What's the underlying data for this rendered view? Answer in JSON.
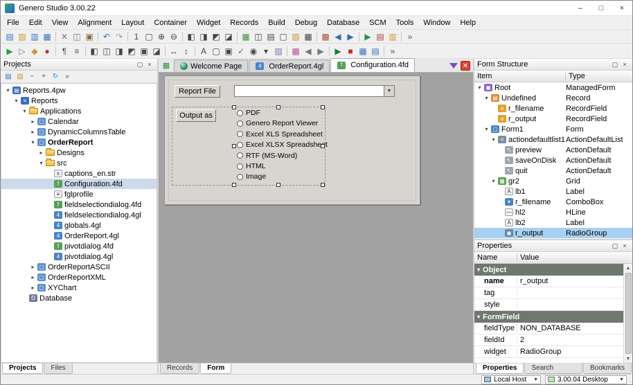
{
  "window": {
    "title": "Genero Studio 3.00.22",
    "controls": [
      {
        "name": "minimize-button",
        "glyph": "–"
      },
      {
        "name": "maximize-button",
        "glyph": "□"
      },
      {
        "name": "close-button",
        "glyph": "×"
      }
    ]
  },
  "menu": {
    "items": [
      "File",
      "Edit",
      "View",
      "Alignment",
      "Layout",
      "Container",
      "Widget",
      "Records",
      "Build",
      "Debug",
      "Database",
      "SCM",
      "Tools",
      "Window",
      "Help"
    ]
  },
  "toolbars": {
    "row1": [
      {
        "name": "new-file",
        "glyph": "▤",
        "color": "#3a6fc4"
      },
      {
        "name": "open-file",
        "glyph": "▧",
        "color": "#c9973a"
      },
      {
        "name": "save-file",
        "glyph": "▥",
        "color": "#3a6fc4"
      },
      {
        "name": "save-all",
        "glyph": "▦",
        "color": "#3a6fc4"
      },
      {
        "sep": true
      },
      {
        "name": "cut",
        "glyph": "✕",
        "color": "#777777"
      },
      {
        "name": "copy",
        "glyph": "◫",
        "color": "#777777"
      },
      {
        "name": "paste",
        "glyph": "▣",
        "color": "#8a6d3b"
      },
      {
        "sep": true
      },
      {
        "name": "undo",
        "glyph": "↶",
        "color": "#3a6fc4"
      },
      {
        "name": "redo",
        "glyph": "↷",
        "color": "#9aa4b0"
      },
      {
        "sep": true
      },
      {
        "name": "tab-order",
        "glyph": "1",
        "color": "#444444"
      },
      {
        "name": "preview-form",
        "glyph": "▢",
        "color": "#444444"
      },
      {
        "name": "zoom-in",
        "glyph": "⊕",
        "color": "#444444"
      },
      {
        "name": "zoom-out",
        "glyph": "⊖",
        "color": "#444444"
      },
      {
        "sep": true
      },
      {
        "name": "align-left-edges",
        "glyph": "◧",
        "color": "#444444"
      },
      {
        "name": "align-right-edges",
        "glyph": "◨",
        "color": "#444444"
      },
      {
        "name": "align-top-edges",
        "glyph": "◩",
        "color": "#444444"
      },
      {
        "name": "align-bottom-edges",
        "glyph": "◪",
        "color": "#444444"
      },
      {
        "sep": true
      },
      {
        "name": "insert-grid",
        "glyph": "▦",
        "color": "#3f8f3f"
      },
      {
        "name": "insert-hbox",
        "glyph": "◫",
        "color": "#444444"
      },
      {
        "name": "insert-vbox",
        "glyph": "▤",
        "color": "#444444"
      },
      {
        "name": "insert-group",
        "glyph": "▢",
        "color": "#444444"
      },
      {
        "name": "insert-folder",
        "glyph": "▧",
        "color": "#c9973a"
      },
      {
        "name": "insert-table",
        "glyph": "▦",
        "color": "#444444"
      },
      {
        "sep": true
      },
      {
        "name": "widget-palette",
        "glyph": "▩",
        "color": "#b0542f"
      },
      {
        "name": "record-previous",
        "glyph": "◀",
        "color": "#2f6fb0"
      },
      {
        "name": "record-next",
        "glyph": "▶",
        "color": "#2f6fb0"
      },
      {
        "sep": true
      },
      {
        "name": "make-executable",
        "glyph": "▶",
        "color": "#2e8f3f"
      },
      {
        "name": "view-report",
        "glyph": "▤",
        "color": "#b03a3a"
      },
      {
        "name": "html-preview",
        "glyph": "▥",
        "color": "#c9973a"
      },
      {
        "sep": true
      },
      {
        "name": "toolbar-overflow-1",
        "glyph": "»",
        "color": "#555555"
      }
    ],
    "row2": [
      {
        "name": "run",
        "glyph": "▶",
        "color": "#2e9e3f"
      },
      {
        "name": "run-settings",
        "glyph": "▷",
        "color": "#777777"
      },
      {
        "name": "build",
        "glyph": "◆",
        "color": "#c9973a"
      },
      {
        "name": "stop-execution",
        "glyph": "●",
        "color": "#c03030"
      },
      {
        "sep": true
      },
      {
        "name": "show-invisibles",
        "glyph": "¶",
        "color": "#555555"
      },
      {
        "name": "line-numbers",
        "glyph": "≡",
        "color": "#555555"
      },
      {
        "sep": true
      },
      {
        "name": "align-left",
        "glyph": "◧",
        "color": "#444444"
      },
      {
        "name": "align-center",
        "glyph": "◫",
        "color": "#444444"
      },
      {
        "name": "align-right",
        "glyph": "◨",
        "color": "#444444"
      },
      {
        "name": "align-top",
        "glyph": "◩",
        "color": "#444444"
      },
      {
        "name": "align-middle",
        "glyph": "▣",
        "color": "#444444"
      },
      {
        "name": "align-bottom",
        "glyph": "◪",
        "color": "#444444"
      },
      {
        "sep": true
      },
      {
        "name": "same-width",
        "glyph": "↔",
        "color": "#444444"
      },
      {
        "name": "same-height",
        "glyph": "↕",
        "color": "#444444"
      },
      {
        "sep": true
      },
      {
        "name": "widget-label",
        "glyph": "A",
        "color": "#444444"
      },
      {
        "name": "widget-edit",
        "glyph": "▢",
        "color": "#444444"
      },
      {
        "name": "widget-button",
        "glyph": "▣",
        "color": "#444444"
      },
      {
        "name": "widget-checkbox",
        "glyph": "✓",
        "color": "#2e8f3f"
      },
      {
        "name": "widget-radiogroup",
        "glyph": "◉",
        "color": "#444444"
      },
      {
        "name": "widget-combobox",
        "glyph": "▾",
        "color": "#444444"
      },
      {
        "name": "widget-image",
        "glyph": "▨",
        "color": "#8a6fb0"
      },
      {
        "sep": true
      },
      {
        "name": "group-colors",
        "glyph": "▩",
        "color": "#c05090"
      },
      {
        "name": "record-first",
        "glyph": "◀",
        "color": "#777777"
      },
      {
        "name": "record-last",
        "glyph": "▶",
        "color": "#777777"
      },
      {
        "sep": true
      },
      {
        "name": "exe-badge",
        "glyph": "▶",
        "color": "#1f7f2f"
      },
      {
        "name": "stop-badge",
        "glyph": "■",
        "color": "#c03030"
      },
      {
        "name": "table-view",
        "glyph": "▦",
        "color": "#3a6fc4"
      },
      {
        "name": "form-view",
        "glyph": "▤",
        "color": "#3a6fc4"
      },
      {
        "sep": true
      },
      {
        "name": "toolbar-overflow-2",
        "glyph": "»",
        "color": "#555555"
      }
    ]
  },
  "projects": {
    "title": "Projects",
    "header_buttons": [
      {
        "name": "float-panel-button",
        "glyph": "▢"
      },
      {
        "name": "close-panel-button",
        "glyph": "×"
      }
    ],
    "toolbar": [
      {
        "name": "project-new",
        "glyph": "▤",
        "color": "#3a6fc4"
      },
      {
        "name": "project-open",
        "glyph": "▧",
        "color": "#c9973a"
      },
      {
        "name": "collapse-all",
        "glyph": "−",
        "color": "#555555"
      },
      {
        "name": "expand-all",
        "glyph": "+",
        "color": "#555555"
      },
      {
        "name": "refresh-project",
        "glyph": "↻",
        "color": "#2f7fd0"
      },
      {
        "name": "panel-overflow",
        "glyph": "»",
        "color": "#555555"
      }
    ],
    "tree": [
      {
        "label": "Reports.4pw",
        "level": 0,
        "expander": "down",
        "icon": "project"
      },
      {
        "label": "Reports",
        "level": 1,
        "expander": "down",
        "icon": "reports-group"
      },
      {
        "label": "Applications",
        "level": 2,
        "expander": "down",
        "icon": "folder"
      },
      {
        "label": "Calendar",
        "level": 3,
        "expander": "right",
        "icon": "app"
      },
      {
        "label": "DynamicColumnsTable",
        "level": 3,
        "expander": "right",
        "icon": "app"
      },
      {
        "label": "OrderReport",
        "level": 3,
        "expander": "down",
        "icon": "app",
        "bold": true
      },
      {
        "label": "Designs",
        "level": 4,
        "expander": "right",
        "icon": "folder"
      },
      {
        "label": "src",
        "level": 4,
        "expander": "down",
        "icon": "folder"
      },
      {
        "label": "captions_en.str",
        "level": 5,
        "icon": "file-str"
      },
      {
        "label": "Configuration.4fd",
        "level": 5,
        "icon": "file-4fd",
        "selected": true
      },
      {
        "label": "fglprofile",
        "level": 5,
        "icon": "file-generic"
      },
      {
        "label": "fieldselectiondialog.4fd",
        "level": 5,
        "icon": "file-4fd"
      },
      {
        "label": "fieldselectiondialog.4gl",
        "level": 5,
        "icon": "file-4gl"
      },
      {
        "label": "globals.4gl",
        "level": 5,
        "icon": "file-4gl"
      },
      {
        "label": "OrderReport.4gl",
        "level": 5,
        "icon": "file-4gl"
      },
      {
        "label": "pivotdialog.4fd",
        "level": 5,
        "icon": "file-4fd"
      },
      {
        "label": "pivotdialog.4gl",
        "level": 5,
        "icon": "file-4gl"
      },
      {
        "label": "OrderReportASCII",
        "level": 3,
        "expander": "right",
        "icon": "app"
      },
      {
        "label": "OrderReportXML",
        "level": 3,
        "expander": "right",
        "icon": "app"
      },
      {
        "label": "XYChart",
        "level": 3,
        "expander": "right",
        "icon": "app"
      },
      {
        "label": "Database",
        "level": 2,
        "icon": "database"
      }
    ],
    "tabs": {
      "items": [
        "Projects",
        "Files"
      ],
      "active": 0
    }
  },
  "editor": {
    "tabs": [
      {
        "label": "Welcome Page",
        "icon": "orb"
      },
      {
        "label": "OrderReport.4gl",
        "icon": "file-4gl"
      },
      {
        "label": "Configuration.4fd",
        "icon": "file-4fd"
      }
    ],
    "active_tab": 2,
    "form": {
      "report_file_label": "Report File",
      "combo_value": "",
      "output_as_label": "Output as",
      "radio_options": [
        "PDF",
        "Genero Report Viewer",
        "Excel XLS Spreadsheet",
        "Excel XLSX Spreadsheet",
        "RTF (MS-Word)",
        "HTML",
        "Image"
      ]
    },
    "bottom_tabs": {
      "items": [
        "Records",
        "Form"
      ],
      "active": 1
    }
  },
  "structure": {
    "title": "Form Structure",
    "header_buttons": [
      {
        "name": "float-panel-button",
        "glyph": "▢"
      },
      {
        "name": "close-panel-button",
        "glyph": "×"
      }
    ],
    "columns": {
      "col1": "Item",
      "col2": "Type"
    },
    "tree": [
      {
        "item": "Root",
        "type": "ManagedForm",
        "level": 0,
        "expander": "down",
        "icon": "managedform"
      },
      {
        "item": "Undefined",
        "type": "Record",
        "level": 1,
        "expander": "down",
        "icon": "record"
      },
      {
        "item": "r_filename",
        "type": "RecordField",
        "level": 2,
        "icon": "recordfield"
      },
      {
        "item": "r_output",
        "type": "RecordField",
        "level": 2,
        "icon": "recordfield"
      },
      {
        "item": "Form1",
        "type": "Form",
        "level": 1,
        "expander": "down",
        "icon": "form"
      },
      {
        "item": "actiondefaultlist1",
        "type": "ActionDefaultList",
        "level": 2,
        "expander": "down",
        "icon": "actionlist"
      },
      {
        "item": "preview",
        "type": "ActionDefault",
        "level": 3,
        "icon": "action"
      },
      {
        "item": "saveOnDisk",
        "type": "ActionDefault",
        "level": 3,
        "icon": "action"
      },
      {
        "item": "quit",
        "type": "ActionDefault",
        "level": 3,
        "icon": "action"
      },
      {
        "item": "gr2",
        "type": "Grid",
        "level": 2,
        "expander": "down",
        "icon": "grid"
      },
      {
        "item": "lb1",
        "type": "Label",
        "level": 3,
        "icon": "label"
      },
      {
        "item": "r_filename",
        "type": "ComboBox",
        "level": 3,
        "icon": "combobox"
      },
      {
        "item": "hl2",
        "type": "HLine",
        "level": 3,
        "icon": "hline"
      },
      {
        "item": "lb2",
        "type": "Label",
        "level": 3,
        "icon": "label"
      },
      {
        "item": "r_output",
        "type": "RadioGroup",
        "level": 3,
        "icon": "radiogroup",
        "selected": true
      }
    ]
  },
  "properties": {
    "title": "Properties",
    "header_buttons": [
      {
        "name": "float-panel-button",
        "glyph": "▢"
      },
      {
        "name": "close-panel-button",
        "glyph": "×"
      }
    ],
    "columns": {
      "col1": "Name",
      "col2": "Value"
    },
    "rows": [
      {
        "section": "Object"
      },
      {
        "name": "name",
        "value": "r_output",
        "bold": true
      },
      {
        "name": "tag",
        "value": ""
      },
      {
        "name": "style",
        "value": ""
      },
      {
        "section": "FormField"
      },
      {
        "name": "fieldType",
        "value": "NON_DATABASE"
      },
      {
        "name": "fieldId",
        "value": "2"
      },
      {
        "name": "widget",
        "value": "RadioGroup"
      }
    ],
    "tabs": {
      "items": [
        "Properties",
        "Function Search",
        "Bookmarks"
      ],
      "active": 0
    }
  },
  "statusbar": {
    "host": "Local Host",
    "desktop": "3.00.04 Desktop"
  }
}
